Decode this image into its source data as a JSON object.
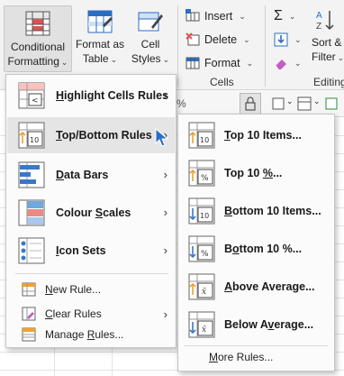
{
  "ribbon": {
    "conditional_formatting": {
      "line1": "Conditional",
      "line2": "Formatting"
    },
    "format_as_table": {
      "line1": "Format as",
      "line2": "Table"
    },
    "cell_styles": {
      "line1": "Cell",
      "line2": "Styles"
    },
    "insert": "Insert",
    "delete": "Delete",
    "format": "Format",
    "cells_group": "Cells",
    "sort_filter": {
      "line1": "Sort &",
      "line2": "Filter"
    },
    "editing_group": "Editing",
    "sigma_symbol": "Σ"
  },
  "strip": {
    "percent_symbol": "%"
  },
  "menu": {
    "items": [
      {
        "label": "Highlight Cells Rules",
        "u": "H",
        "rest": "ighlight Cells Rules",
        "icon": "highlight-cells-rules-icon"
      },
      {
        "label": "Top/Bottom Rules",
        "u": "T",
        "rest": "op/Bottom Rules",
        "icon": "top-bottom-rules-icon"
      },
      {
        "label": "Data Bars",
        "u": "D",
        "rest": "ata Bars",
        "icon": "data-bars-icon"
      },
      {
        "label": "Colour Scales",
        "pre": "Colour ",
        "u": "S",
        "rest": "cales",
        "icon": "colour-scales-icon"
      },
      {
        "label": "Icon Sets",
        "u": "I",
        "rest": "con Sets",
        "icon": "icon-sets-icon"
      }
    ],
    "new_rule": {
      "u": "N",
      "rest": "ew Rule..."
    },
    "clear_rules": {
      "u": "C",
      "rest": "lear Rules"
    },
    "manage_rules": {
      "pre": "Manage ",
      "u": "R",
      "rest": "ules..."
    }
  },
  "submenu": {
    "items": [
      {
        "pre": "",
        "u": "T",
        "rest": "op 10 Items...",
        "icon_text": "10"
      },
      {
        "pre": "Top 10 ",
        "u": "%",
        "rest": "...",
        "icon_text": "%"
      },
      {
        "pre": "",
        "u": "B",
        "rest": "ottom 10 Items...",
        "icon_text": "10"
      },
      {
        "pre": "B",
        "u": "o",
        "rest": "ttom 10 %...",
        "icon_text": "%"
      },
      {
        "pre": "",
        "u": "A",
        "rest": "bove Average...",
        "icon_text": "x̄"
      },
      {
        "pre": "Below A",
        "u": "v",
        "rest": "erage...",
        "icon_text": "x̄"
      }
    ],
    "more_rules": {
      "pre": "",
      "u": "M",
      "rest": "ore Rules..."
    }
  },
  "colors": {
    "accent_blue": "#2b6cc4",
    "active_item": "#e5e5e5",
    "menu_bg": "#fbfbfb",
    "icon_red": "#d9534f",
    "icon_orange": "#f0a030"
  }
}
